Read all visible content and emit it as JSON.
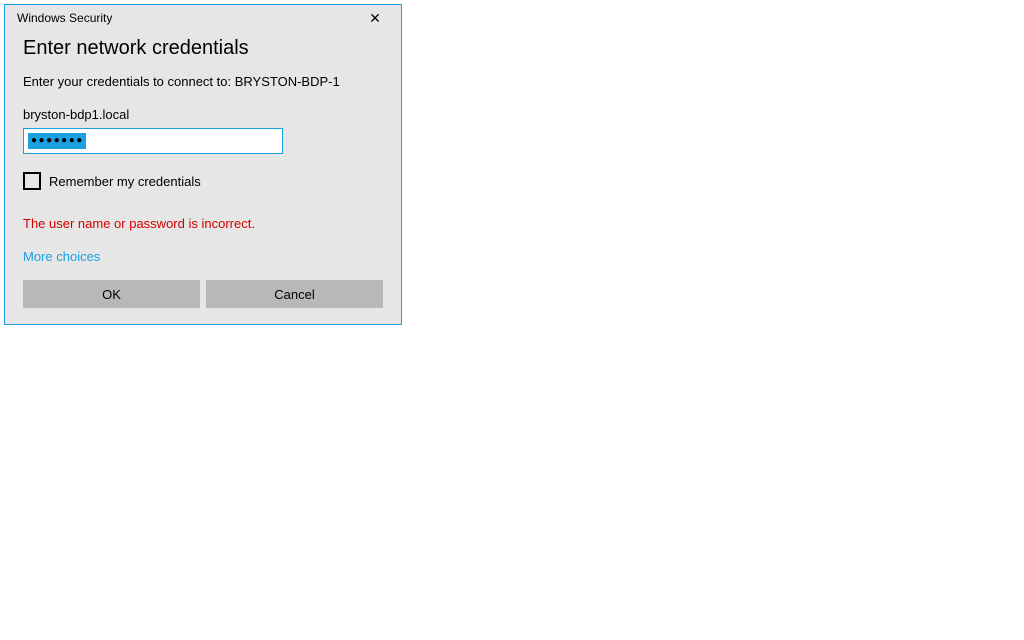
{
  "titlebar": {
    "title": "Windows Security",
    "close_glyph": "✕"
  },
  "heading": "Enter network credentials",
  "instruction": "Enter your credentials to connect to: BRYSTON-BDP-1",
  "username": "bryston-bdp1.local",
  "password_masked": "●●●●●●●",
  "remember_label": "Remember my credentials",
  "error_message": "The user name or password is incorrect.",
  "more_choices_label": "More choices",
  "buttons": {
    "ok": "OK",
    "cancel": "Cancel"
  }
}
